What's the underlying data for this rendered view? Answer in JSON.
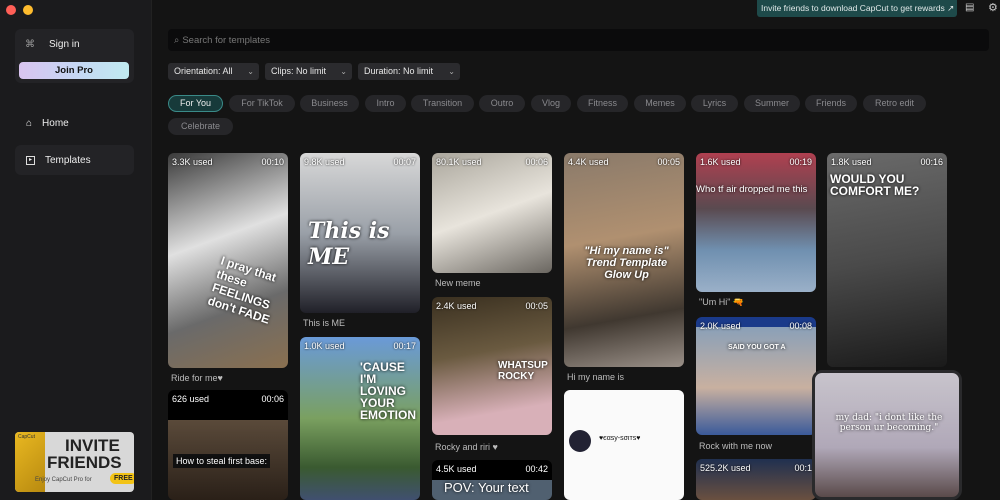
{
  "window": {
    "dots": [
      "#ff5f57",
      "#febc2e"
    ]
  },
  "sidebar": {
    "sign_in": "Sign in",
    "join_pro": "Join Pro",
    "items": [
      {
        "label": "Home",
        "icon": "home-icon"
      },
      {
        "label": "Templates",
        "icon": "templates-icon"
      }
    ],
    "invite_banner": {
      "title1": "INVITE",
      "title2": "FRIENDS",
      "sub": "Enjoy CapCut Pro for",
      "free": "FREE",
      "brand": "CapCut"
    }
  },
  "topbar": {
    "invite_text": "Invite friends to download CapCut to get rewards ↗"
  },
  "search": {
    "placeholder": "Search for templates"
  },
  "filters": [
    {
      "label": "Orientation: All"
    },
    {
      "label": "Clips: No limit"
    },
    {
      "label": "Duration: No limit"
    }
  ],
  "categories": [
    "For You",
    "For TikTok",
    "Business",
    "Intro",
    "Transition",
    "Outro",
    "Vlog",
    "Fitness",
    "Memes",
    "Lyrics",
    "Summer",
    "Friends",
    "Retro edit",
    "Celebrate"
  ],
  "active_category": "For You",
  "templates": [
    {
      "used": "3.3K used",
      "duration": "00:10",
      "caption": "Ride for me♥",
      "overlay": "I pray that these FEELINGS don't FADE"
    },
    {
      "used": "626 used",
      "duration": "00:06",
      "overlay": "How to steal first base:"
    },
    {
      "used": "9.8K used",
      "duration": "00:07",
      "caption": "This is ME",
      "overlay": "This is ME"
    },
    {
      "used": "1.0K used",
      "duration": "00:17",
      "overlay": "'CAUSE I'M LOVING YOUR EMOTION"
    },
    {
      "used": "80.1K used",
      "duration": "00:06",
      "caption": "New meme"
    },
    {
      "used": "2.4K used",
      "duration": "00:05",
      "caption": "Rocky and riri ♥",
      "overlay": "WHATSUP ROCKY"
    },
    {
      "used": "4.5K used",
      "duration": "00:42",
      "overlay": "POV: Your text"
    },
    {
      "used": "4.4K used",
      "duration": "00:05",
      "caption": "Hi my name is",
      "overlay": "\"Hi my name is\" Trend Template Glow Up"
    },
    {
      "overlay": "♥єαѕу-ѕσιтѕ♥"
    },
    {
      "used": "1.6K used",
      "duration": "00:19",
      "caption": "\"Um Hi\" 🔫",
      "overlay": "Who tf air dropped me this"
    },
    {
      "used": "2.0K used",
      "duration": "00:08",
      "caption": "Rock with me now",
      "overlay": "SAID YOU GOT A"
    },
    {
      "used": "525.2K used",
      "duration": "00:1"
    },
    {
      "used": "1.8K used",
      "duration": "00:16",
      "overlay": "WOULD YOU COMFORT ME?"
    },
    {
      "overlay": "my dad: \"i dont like the person ur becoming.\""
    }
  ]
}
